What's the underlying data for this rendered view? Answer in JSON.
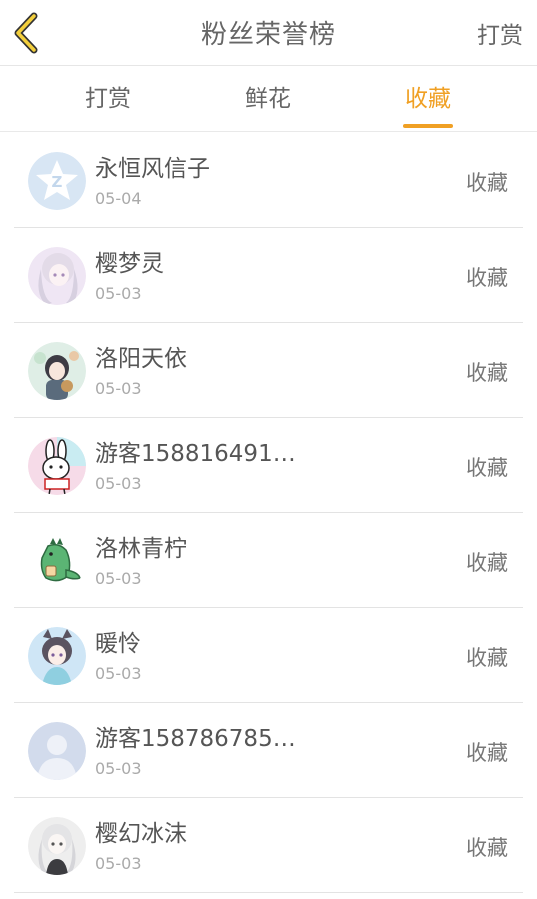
{
  "header": {
    "title": "粉丝荣誉榜",
    "action_label": "打赏",
    "back_icon": "chevron-left-icon",
    "accent_color": "#f0a024"
  },
  "tabs": [
    {
      "label": "打赏",
      "active": false
    },
    {
      "label": "鲜花",
      "active": false
    },
    {
      "label": "收藏",
      "active": true
    }
  ],
  "fans": [
    {
      "name": "永恒风信子",
      "date": "05-04",
      "action": "收藏",
      "avatar": "default-star-avatar"
    },
    {
      "name": "樱梦灵",
      "date": "05-03",
      "action": "收藏",
      "avatar": "anime-girl-avatar"
    },
    {
      "name": "洛阳天依",
      "date": "05-03",
      "action": "收藏",
      "avatar": "anime-girl-avatar"
    },
    {
      "name": "游客158816491…",
      "date": "05-03",
      "action": "收藏",
      "avatar": "bunny-avatar"
    },
    {
      "name": "洛林青柠",
      "date": "05-03",
      "action": "收藏",
      "avatar": "dinosaur-avatar"
    },
    {
      "name": "暖怜",
      "date": "05-03",
      "action": "收藏",
      "avatar": "anime-girl-avatar"
    },
    {
      "name": "游客158786785…",
      "date": "05-03",
      "action": "收藏",
      "avatar": "default-person-avatar"
    },
    {
      "name": "樱幻冰沫",
      "date": "05-03",
      "action": "收藏",
      "avatar": "anime-girl-avatar"
    }
  ]
}
